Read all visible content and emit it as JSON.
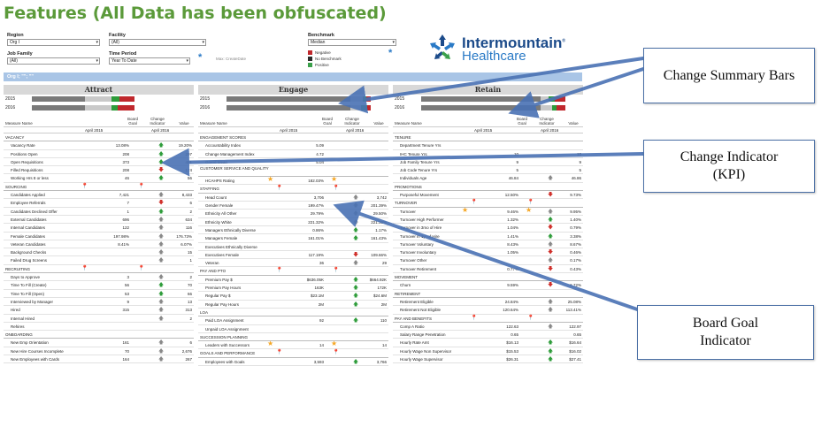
{
  "title": "Features (All Data has been obfuscated)",
  "filters": {
    "region": {
      "label": "Region",
      "value": "Org I"
    },
    "facility": {
      "label": "Facility",
      "value": "(All)"
    },
    "job_family": {
      "label": "Job Family",
      "value": "(All)"
    },
    "time_period": {
      "label": "Time Period",
      "value": "Year To Date"
    },
    "benchmark": {
      "label": "Benchmark",
      "value": "Median"
    },
    "max_date_note": "Max: CreateDate"
  },
  "benchmark_legend": [
    {
      "label": "Negative",
      "color": "#c0282d"
    },
    {
      "label": "No Benchmark",
      "color": "#2b2b2b"
    },
    {
      "label": "Positive",
      "color": "#3aa04a"
    }
  ],
  "logo": {
    "line1": "Intermountain",
    "reg": "®",
    "line2": "Healthcare"
  },
  "org_band": "Org I; \"\"; \"\"",
  "panels": [
    {
      "title": "Attract",
      "summary": [
        {
          "year": "2015",
          "bars": [
            {
              "w": 60,
              "c": "#7a7a7a"
            },
            {
              "w": 30,
              "c": "#c9c9c9"
            },
            {
              "w": 9,
              "c": "#2e9c3a"
            },
            {
              "w": 17,
              "c": "#c0282d"
            }
          ]
        },
        {
          "year": "2016",
          "bars": [
            {
              "w": 60,
              "c": "#7a7a7a"
            },
            {
              "w": 30,
              "c": "#c9c9c9"
            },
            {
              "w": 7,
              "c": "#2e9c3a"
            },
            {
              "w": 19,
              "c": "#c0282d"
            }
          ]
        }
      ],
      "headers": {
        "measure": "Measure Name",
        "board": "Board Goal",
        "change": "Change Indicator",
        "value": "Value"
      },
      "periods": [
        "April 2015",
        "April 2016"
      ],
      "rows": [
        {
          "t": "sec",
          "name": "VACANCY"
        },
        {
          "name": "Vacancy Rate",
          "v1": "13.08%",
          "ind": "up",
          "v2": "19.20%"
        },
        {
          "name": "Positions Open",
          "v1": "208",
          "ind": "up",
          "v2": "297"
        },
        {
          "name": "Open Requisitions",
          "v1": "373",
          "ind": "up",
          "v2": "481"
        },
        {
          "name": "Filled Requisitions",
          "v1": "208",
          "ind": "dn",
          "v2": "174"
        },
        {
          "name": "Working Hrs 8 or less",
          "v1": "46",
          "ind": "up",
          "v2": "56"
        },
        {
          "t": "sec",
          "name": "SOURCING",
          "pin": true
        },
        {
          "name": "Candidates Applied",
          "v1": "7,421",
          "ind": "ne",
          "v2": "8,433"
        },
        {
          "name": "Employee Referrals",
          "v1": "7",
          "ind": "dn",
          "v2": "6"
        },
        {
          "name": "Candidates Declined Offer",
          "v1": "1",
          "ind": "up",
          "v2": "2"
        },
        {
          "name": "External Candidates",
          "v1": "696",
          "ind": "ne",
          "v2": "634"
        },
        {
          "name": "Internal Candidates",
          "v1": "122",
          "ind": "ne",
          "v2": "116"
        },
        {
          "name": "Female Candidates",
          "v1": "197.98%",
          "ind": "ne",
          "v2": "176.73%"
        },
        {
          "name": "Veteran Candidates",
          "v1": "8.41%",
          "ind": "ne",
          "v2": "6.07%"
        },
        {
          "name": "Background Checks",
          "v1": "",
          "ind": "ne",
          "v2": "15"
        },
        {
          "name": "Failed Drug Screens",
          "v1": "",
          "ind": "ne",
          "v2": "1"
        },
        {
          "t": "sec",
          "name": "RECRUITING",
          "pin": true
        },
        {
          "name": "Days to Approve",
          "v1": "3",
          "ind": "ne",
          "v2": "2"
        },
        {
          "name": "Time To Fill (Create)",
          "v1": "56",
          "ind": "up",
          "v2": "70"
        },
        {
          "name": "Time To Fill (Open)",
          "v1": "53",
          "ind": "up",
          "v2": "66"
        },
        {
          "name": "Interviewed by Manager",
          "v1": "9",
          "ind": "ne",
          "v2": "13"
        },
        {
          "name": "Hired",
          "v1": "315",
          "ind": "ne",
          "v2": "313"
        },
        {
          "name": "Internal Hired",
          "v1": "",
          "ind": "ne",
          "v2": "2"
        },
        {
          "name": "Rehires",
          "v1": "",
          "ind": "",
          "v2": ""
        },
        {
          "t": "sec",
          "name": "ONBOARDING"
        },
        {
          "name": "New Emp Orientation",
          "v1": "161",
          "ind": "ne",
          "v2": "6"
        },
        {
          "name": "New Hire Courses Incomplete",
          "v1": "70",
          "ind": "ne",
          "v2": "2,676"
        },
        {
          "name": "New Employees with Cards",
          "v1": "164",
          "ind": "ne",
          "v2": "267"
        }
      ]
    },
    {
      "title": "Engage",
      "summary": [
        {
          "year": "2015",
          "bars": [
            {
              "w": 140,
              "c": "#7a7a7a"
            },
            {
              "w": 14,
              "c": "#c9c9c9"
            },
            {
              "w": 4,
              "c": "#2e9c3a"
            },
            {
              "w": 5,
              "c": "#c0282d"
            }
          ]
        },
        {
          "year": "2016",
          "bars": [
            {
              "w": 140,
              "c": "#7a7a7a"
            },
            {
              "w": 12,
              "c": "#c9c9c9"
            },
            {
              "w": 7,
              "c": "#2e9c3a"
            },
            {
              "w": 4,
              "c": "#c0282d"
            }
          ]
        }
      ],
      "headers": {
        "measure": "Measure Name",
        "board": "Board Goal",
        "change": "Change Indicator",
        "value": "Value"
      },
      "periods": [
        "April 2015",
        "April 2016"
      ],
      "rows": [
        {
          "t": "sec",
          "name": "ENGAGEMENT SCORES"
        },
        {
          "name": "Accountability Index",
          "v1": "5.09",
          "ind": "",
          "v2": ""
        },
        {
          "name": "Change Management Index",
          "v1": "4.72",
          "ind": "",
          "v2": ""
        },
        {
          "name": "Grand Mean",
          "v1": "5.04",
          "ind": "",
          "v2": ""
        },
        {
          "t": "sec",
          "name": "CUSTOMER SERVICE AND QUALITY",
          "tall": true
        },
        {
          "name": "HCAHPS Rating",
          "v1": "182.03%",
          "ind": "",
          "v2": "",
          "star1": true,
          "star2": true
        },
        {
          "t": "sec",
          "name": "STAFFING",
          "pin": true
        },
        {
          "name": "Head Count",
          "v1": "3,706",
          "ind": "ne",
          "v2": "3,742"
        },
        {
          "name": "Gender Female",
          "v1": "199.47%",
          "ind": "ne",
          "v2": "201.39%"
        },
        {
          "name": "Ethnicity All Other",
          "v1": "29.79%",
          "ind": "ne",
          "v2": "29.50%"
        },
        {
          "name": "Ethnicity White",
          "v1": "221.32%",
          "ind": "ne",
          "v2": "221.30%"
        },
        {
          "name": "Managers Ethnically Diverse",
          "v1": "0.86%",
          "ind": "up",
          "v2": "1.17%"
        },
        {
          "name": "Managers Female",
          "v1": "161.01%",
          "ind": "up",
          "v2": "161.43%"
        },
        {
          "name": "Executives Ethnically Diverse",
          "v1": "",
          "ind": "",
          "v2": ""
        },
        {
          "name": "Executives Female",
          "v1": "117.19%",
          "ind": "dn",
          "v2": "109.66%"
        },
        {
          "name": "Veteran",
          "v1": "36",
          "ind": "ne",
          "v2": "29"
        },
        {
          "t": "sec",
          "name": "PAY AND PTO",
          "pin": true
        },
        {
          "name": "Premium Pay $",
          "v1": "$636.05K",
          "ind": "up",
          "v2": "$664.92K"
        },
        {
          "name": "Premium Pay Hours",
          "v1": "163K",
          "ind": "up",
          "v2": "172K"
        },
        {
          "name": "Regular Pay $",
          "v1": "$23.1M",
          "ind": "up",
          "v2": "$24.6M"
        },
        {
          "name": "Regular Pay Hours",
          "v1": "2M",
          "ind": "up",
          "v2": "2M"
        },
        {
          "t": "sec",
          "name": "LOA"
        },
        {
          "name": "Paid LOA Assignment",
          "v1": "92",
          "ind": "up",
          "v2": "110"
        },
        {
          "name": "Unpaid LOA Assignment",
          "v1": "",
          "ind": "",
          "v2": ""
        },
        {
          "t": "sec",
          "name": "SUCCESSION PLANNING"
        },
        {
          "name": "Leaders with Successors",
          "v1": "14",
          "ind": "",
          "v2": "14",
          "star1": true,
          "star2": true
        },
        {
          "t": "sec",
          "name": "GOALS AND PERFORMANCE",
          "pin": true
        },
        {
          "name": "Employees with Goals",
          "v1": "3,593",
          "ind": "up",
          "v2": "3,766"
        }
      ]
    },
    {
      "title": "Retain",
      "summary": [
        {
          "year": "2015",
          "bars": [
            {
              "w": 135,
              "c": "#7a7a7a"
            },
            {
              "w": 9,
              "c": "#c9c9c9"
            },
            {
              "w": 7,
              "c": "#2e9c3a"
            },
            {
              "w": 12,
              "c": "#c0282d"
            }
          ]
        },
        {
          "year": "2016",
          "bars": [
            {
              "w": 135,
              "c": "#7a7a7a"
            },
            {
              "w": 13,
              "c": "#c9c9c9"
            },
            {
              "w": 5,
              "c": "#2e9c3a"
            },
            {
              "w": 10,
              "c": "#c0282d"
            }
          ]
        }
      ],
      "headers": {
        "measure": "Measure Name",
        "board": "Board Goal",
        "change": "Change Indicator",
        "value": "Value"
      },
      "periods": [
        "April 2015",
        "April 2016"
      ],
      "rows": [
        {
          "t": "sec",
          "name": "TENURE"
        },
        {
          "name": "Department Tenure Yrs",
          "v1": "",
          "ind": "",
          "v2": ""
        },
        {
          "name": "IHC Tenure Yrs",
          "v1": "10",
          "ind": "",
          "v2": "10"
        },
        {
          "name": "Job Family Tenure Yrs",
          "v1": "9",
          "ind": "",
          "v2": "9"
        },
        {
          "name": "Job Code Tenure Yrs",
          "v1": "5",
          "ind": "",
          "v2": "5"
        },
        {
          "name": "Individuals Age",
          "v1": "46.84",
          "ind": "ne",
          "v2": "46.86"
        },
        {
          "t": "sec",
          "name": "PROMOTIONS"
        },
        {
          "name": "Purposeful Movement",
          "v1": "12.50%",
          "ind": "dn",
          "v2": "9.73%"
        },
        {
          "t": "sec",
          "name": "TURNOVER",
          "pin": true
        },
        {
          "name": "Turnover",
          "v1": "9.46%",
          "ind": "ne",
          "v2": "9.95%",
          "star1": true,
          "star2": true
        },
        {
          "name": "Turnover High Performer",
          "v1": "1.32%",
          "ind": "up",
          "v2": "1.40%"
        },
        {
          "name": "Turnover in 3mo of Hire",
          "v1": "1.04%",
          "ind": "dn",
          "v2": "0.79%"
        },
        {
          "name": "Turnover in 1yr of Hire",
          "v1": "1.41%",
          "ind": "up",
          "v2": "3.38%"
        },
        {
          "name": "Turnover Voluntary",
          "v1": "8.43%",
          "ind": "ne",
          "v2": "8.67%"
        },
        {
          "name": "Turnover Involuntary",
          "v1": "1.05%",
          "ind": "dn",
          "v2": "0.46%"
        },
        {
          "name": "Turnover Other",
          "v1": "",
          "ind": "ne",
          "v2": "0.17%"
        },
        {
          "name": "Turnover Retirement",
          "v1": "0.77%",
          "ind": "dn",
          "v2": "0.43%"
        },
        {
          "t": "sec",
          "name": "MOVEMENT"
        },
        {
          "name": "Churn",
          "v1": "9.59%",
          "ind": "dn",
          "v2": "6.72%"
        },
        {
          "t": "sec",
          "name": "RETIREMENT"
        },
        {
          "name": "Retirement Eligible",
          "v1": "24.84%",
          "ind": "ne",
          "v2": "25.08%"
        },
        {
          "name": "Retirement Not Eligible",
          "v1": "120.64%",
          "ind": "ne",
          "v2": "113.41%"
        },
        {
          "t": "sec",
          "name": "PAY AND BENEFITS",
          "pin": true
        },
        {
          "name": "Comp A Ratio",
          "v1": "122.63",
          "ind": "ne",
          "v2": "122.97"
        },
        {
          "name": "Salary Range Penetration",
          "v1": "0.65",
          "ind": "",
          "v2": "0.65"
        },
        {
          "name": "Hourly Rate Amt",
          "v1": "$16.13",
          "ind": "up",
          "v2": "$16.64"
        },
        {
          "name": "Hourly Wage Non Supervisor",
          "v1": "$15.53",
          "ind": "up",
          "v2": "$16.02"
        },
        {
          "name": "Hourly Wage Supervisor",
          "v1": "$26.31",
          "ind": "up",
          "v2": "$27.41"
        }
      ]
    }
  ],
  "callouts": {
    "summary_bars": "Change Summary Bars",
    "change_indicator": "Change Indicator (KPI)",
    "board_goal": "Board Goal Indicator"
  },
  "icons": {
    "up": "▲ (green arrow up)",
    "down": "▼ (red arrow down)",
    "neutral": "grey arrow",
    "pin": "blue pin",
    "star": "gold star"
  }
}
